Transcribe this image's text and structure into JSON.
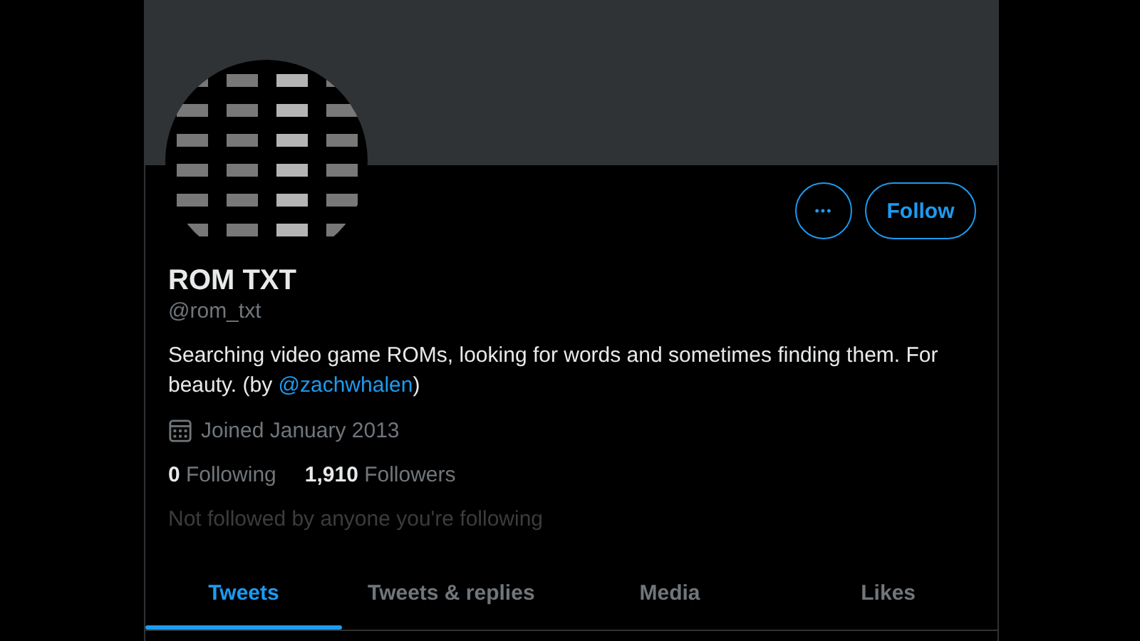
{
  "profile": {
    "name": "ROM TXT",
    "handle": "@rom_txt",
    "bio": "Searching video game ROMs, looking for words and sometimes finding them. For beauty. (by ",
    "bio_link": "@zachwhalen",
    "bio_end": ")",
    "joined": "Joined January 2013"
  },
  "actions": {
    "more": "•••",
    "follow": "Follow"
  },
  "stats": [
    {
      "count": "0",
      "label": "Following"
    },
    {
      "count": "1,910",
      "label": "Followers"
    }
  ],
  "followed_note": "Not followed by anyone you're following",
  "tabs": [
    {
      "label": "Tweets",
      "selected": true
    },
    {
      "label": "Tweets & replies",
      "selected": false
    },
    {
      "label": "Media",
      "selected": false
    },
    {
      "label": "Likes",
      "selected": false
    }
  ]
}
